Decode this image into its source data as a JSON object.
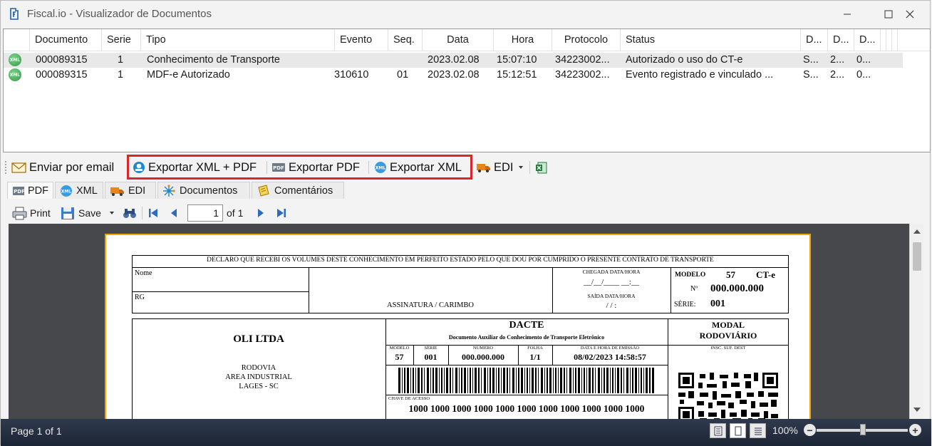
{
  "window": {
    "title": "Fiscal.io - Visualizador de Documentos"
  },
  "grid": {
    "columns": [
      "Documento",
      "Serie",
      "Tipo",
      "Evento",
      "Seq.",
      "Data",
      "Hora",
      "Protocolo",
      "Status",
      "D...",
      "D...",
      "D..."
    ],
    "rows": [
      {
        "documento": "000089315",
        "serie": "1",
        "tipo": "Conhecimento de Transporte",
        "evento": "",
        "seq": "",
        "data": "2023.02.08",
        "hora": "15:07:10",
        "protocolo": "34223002...",
        "status": "Autorizado o uso do CT-e",
        "d1": "S...",
        "d2": "2...",
        "d3": "0..."
      },
      {
        "documento": "000089315",
        "serie": "1",
        "tipo": "MDF-e Autorizado",
        "evento": "310610",
        "seq": "01",
        "data": "2023.02.08",
        "hora": "15:12:51",
        "protocolo": "34223002...",
        "status": "Evento registrado e vinculado ...",
        "d1": "S...",
        "d2": "2...",
        "d3": "0..."
      }
    ]
  },
  "toolbar": {
    "email": "Enviar por email",
    "export_xml_pdf": "Exportar XML + PDF",
    "export_pdf": "Exportar PDF",
    "export_xml": "Exportar XML",
    "edi": "EDI"
  },
  "tabs": [
    "PDF",
    "XML",
    "EDI",
    "Documentos",
    "Comentários"
  ],
  "viewer_toolbar": {
    "print": "Print",
    "save": "Save",
    "page_value": "1",
    "of_pages": "of 1"
  },
  "document": {
    "declaration": "DECLARO QUE RECEBI OS VOLUMES DESTE CONHECIMENTO EM PERFEITO ESTADO PELO QUE DOU POR CUMPRIDO O PRESENTE CONTRATO DE TRANSPORTE",
    "nome": "Nome",
    "rg": "RG",
    "assinatura": "ASSINATURA / CARIMBO",
    "chegada": "CHEGADA DATA/HORA",
    "chegada_blank": "__/__/____  __:__",
    "saida": "SAÍDA DATA/HORA",
    "saida_blank": "/    /              :",
    "modelo_label": "MODELO",
    "modelo_value": "57",
    "cte": "CT-e",
    "numero_label": "Nº",
    "numero_value": "000.000.000",
    "serie_label": "SÉRIE:",
    "serie_value": "001",
    "company": "OLI LTDA",
    "addr1": "RODOVIA",
    "addr2": "AREA INDUSTRIAL",
    "addr3": "LAGES - SC",
    "dacte": "DACTE",
    "dacte_sub": "Documento Auxiliar do Conhecimento de Transporte Eletrônico",
    "f_modelo": "MODELO",
    "f_serie": "SÉRIE",
    "f_numero": "NÚMERO",
    "f_folha": "FOLHA",
    "f_emissao": "DATA E HORA DE EMISSÃO",
    "v_modelo": "57",
    "v_serie": "001",
    "v_numero": "000.000.000",
    "v_folha": "1/1",
    "v_emissao": "08/02/2023 14:58:57",
    "modal": "MODAL",
    "modal_value": "RODOVIÁRIO",
    "insc": "INSC. SUF. DEST",
    "chave_label": "CHAVE DE ACESSO",
    "chave_value": "1000 1000 1000 1000 1000 1000 1000 1000 1000 1000 1000"
  },
  "statusbar": {
    "page": "Page 1 of 1",
    "zoom": "100%"
  }
}
